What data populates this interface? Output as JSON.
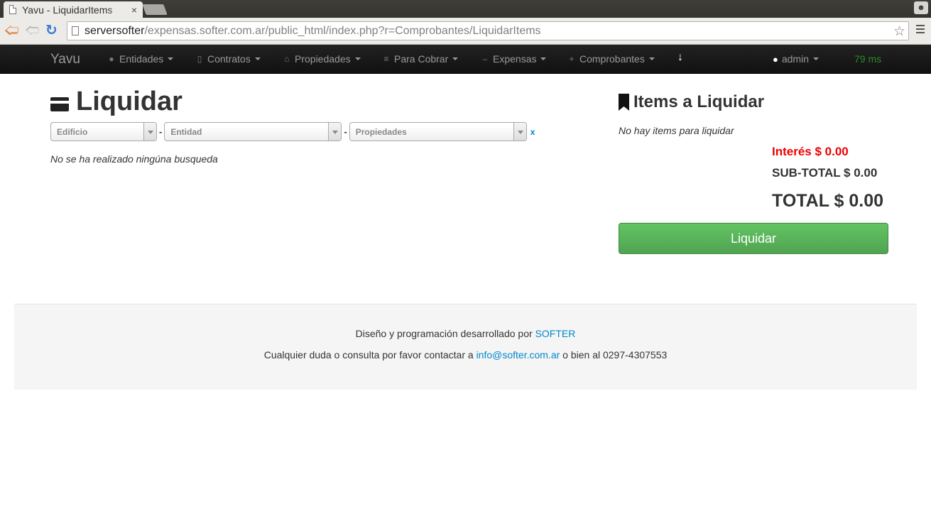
{
  "browser": {
    "tab_title": "Yavu - LiquidarItems",
    "tab_close": "×",
    "url_host": "serversofter",
    "url_path": "/expensas.softer.com.ar/public_html/index.php?r=Comprobantes/LiquidarItems"
  },
  "navbar": {
    "brand": "Yavu",
    "items": [
      {
        "label": "Entidades",
        "icon": "user-icon"
      },
      {
        "label": "Contratos",
        "icon": "file-icon"
      },
      {
        "label": "Propiedades",
        "icon": "home-icon"
      },
      {
        "label": "Para Cobrar",
        "icon": "list-icon"
      },
      {
        "label": "Expensas",
        "icon": "minus-icon"
      },
      {
        "label": "Comprobantes",
        "icon": "plus-icon"
      }
    ],
    "user": "admin",
    "timing": "79 ms"
  },
  "main": {
    "title": "Liquidar",
    "filters": {
      "edificio": "Edificio",
      "entidad": "Entidad",
      "propiedades": "Propiedades",
      "clear": "x"
    },
    "no_search_msg": "No se ha realizado ningúna busqueda"
  },
  "sidebar": {
    "title": "Items a Liquidar",
    "empty_msg": "No hay items para liquidar",
    "interes": "Interés $ 0.00",
    "subtotal": "SUB-TOTAL $ 0.00",
    "total": "TOTAL $ 0.00",
    "button": "Liquidar"
  },
  "footer": {
    "line1_prefix": "Diseño y programación desarrollado por ",
    "line1_link": "SOFTER",
    "line2_prefix": "Cualquier duda o consulta por favor contactar a ",
    "line2_link": "info@softer.com.ar",
    "line2_suffix": " o bien al 0297-4307553"
  },
  "colors": {
    "navbar_bg": "#1b1b1b",
    "success": "#5bb75b",
    "danger": "#ee0000",
    "link": "#0088cc",
    "timing": "#2b8a2b"
  }
}
